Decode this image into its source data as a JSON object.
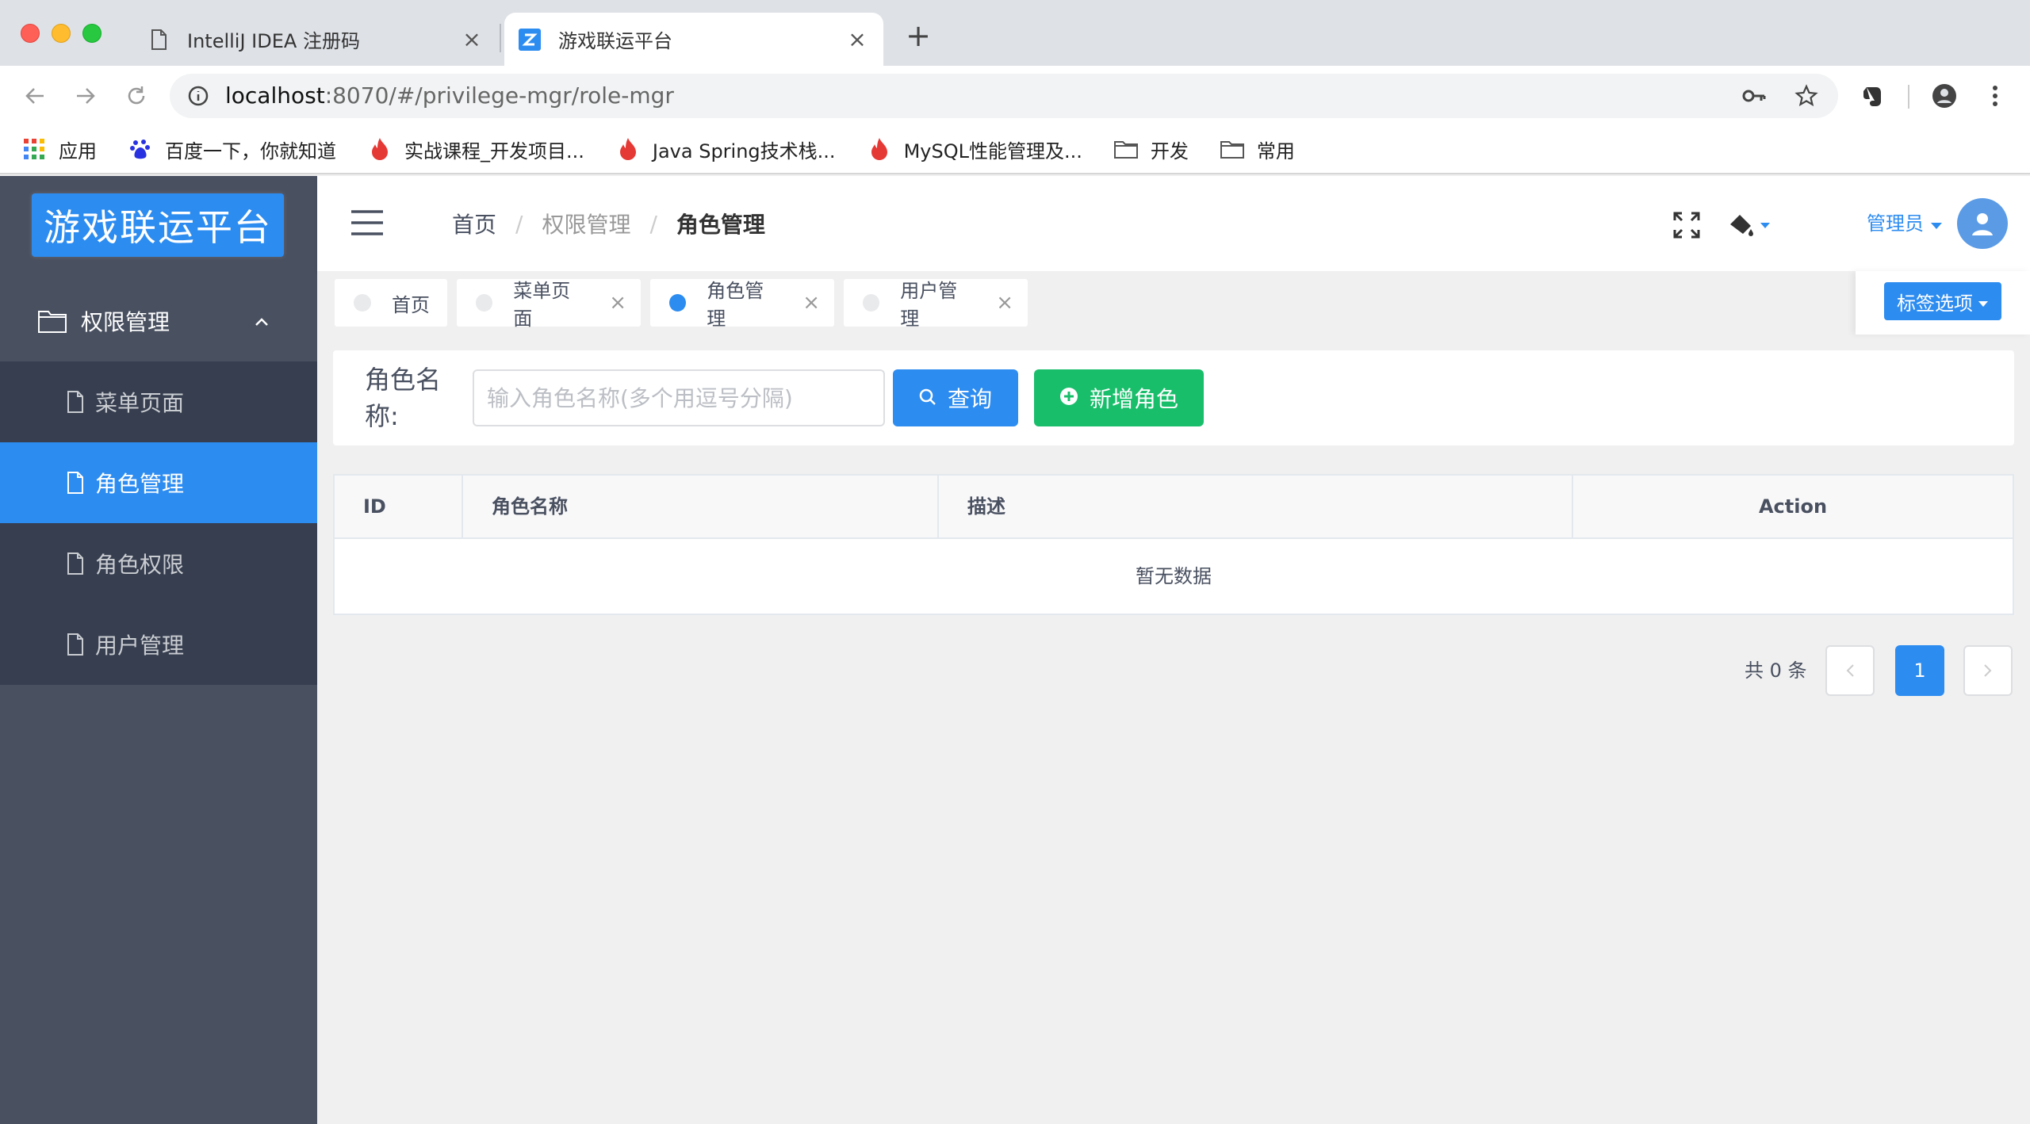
{
  "browser": {
    "tabs": [
      {
        "title": "IntelliJ IDEA 注册码",
        "active": false
      },
      {
        "title": "游戏联运平台",
        "active": true
      }
    ],
    "url_host": "localhost",
    "url_rest": ":8070/#/privilege-mgr/role-mgr",
    "bookmarks": [
      {
        "label": "应用",
        "icon": "apps-grid-icon"
      },
      {
        "label": "百度一下，你就知道",
        "icon": "baidu-paw-icon"
      },
      {
        "label": "实战课程_开发项目...",
        "icon": "flame-icon"
      },
      {
        "label": "Java Spring技术栈...",
        "icon": "flame-icon"
      },
      {
        "label": "MySQL性能管理及...",
        "icon": "flame-icon"
      },
      {
        "label": "开发",
        "icon": "folder-icon"
      },
      {
        "label": "常用",
        "icon": "folder-icon"
      }
    ]
  },
  "sidebar": {
    "logo": "游戏联运平台",
    "group": "权限管理",
    "items": [
      {
        "label": "菜单页面",
        "active": false
      },
      {
        "label": "角色管理",
        "active": true
      },
      {
        "label": "角色权限",
        "active": false
      },
      {
        "label": "用户管理",
        "active": false
      }
    ]
  },
  "header": {
    "breadcrumb": [
      "首页",
      "权限管理",
      "角色管理"
    ],
    "user": "管理员"
  },
  "tags": {
    "items": [
      {
        "label": "首页",
        "active": false,
        "closable": false
      },
      {
        "label": "菜单页面",
        "active": false,
        "closable": true
      },
      {
        "label": "角色管理",
        "active": true,
        "closable": true
      },
      {
        "label": "用户管理",
        "active": false,
        "closable": true
      }
    ],
    "options_label": "标签选项"
  },
  "search": {
    "label": "角色名称:",
    "placeholder": "输入角色名称(多个用逗号分隔)",
    "value": "",
    "query_label": "查询",
    "add_label": "新增角色"
  },
  "table": {
    "columns": [
      "ID",
      "角色名称",
      "描述",
      "Action"
    ],
    "rows": [],
    "empty_text": "暂无数据"
  },
  "pagination": {
    "total_text": "共 0 条",
    "current_page": "1"
  },
  "colors": {
    "primary": "#2d8cf0",
    "success": "#19be6b",
    "sidebar_bg": "#495060",
    "submenu_bg": "#363e4f"
  }
}
